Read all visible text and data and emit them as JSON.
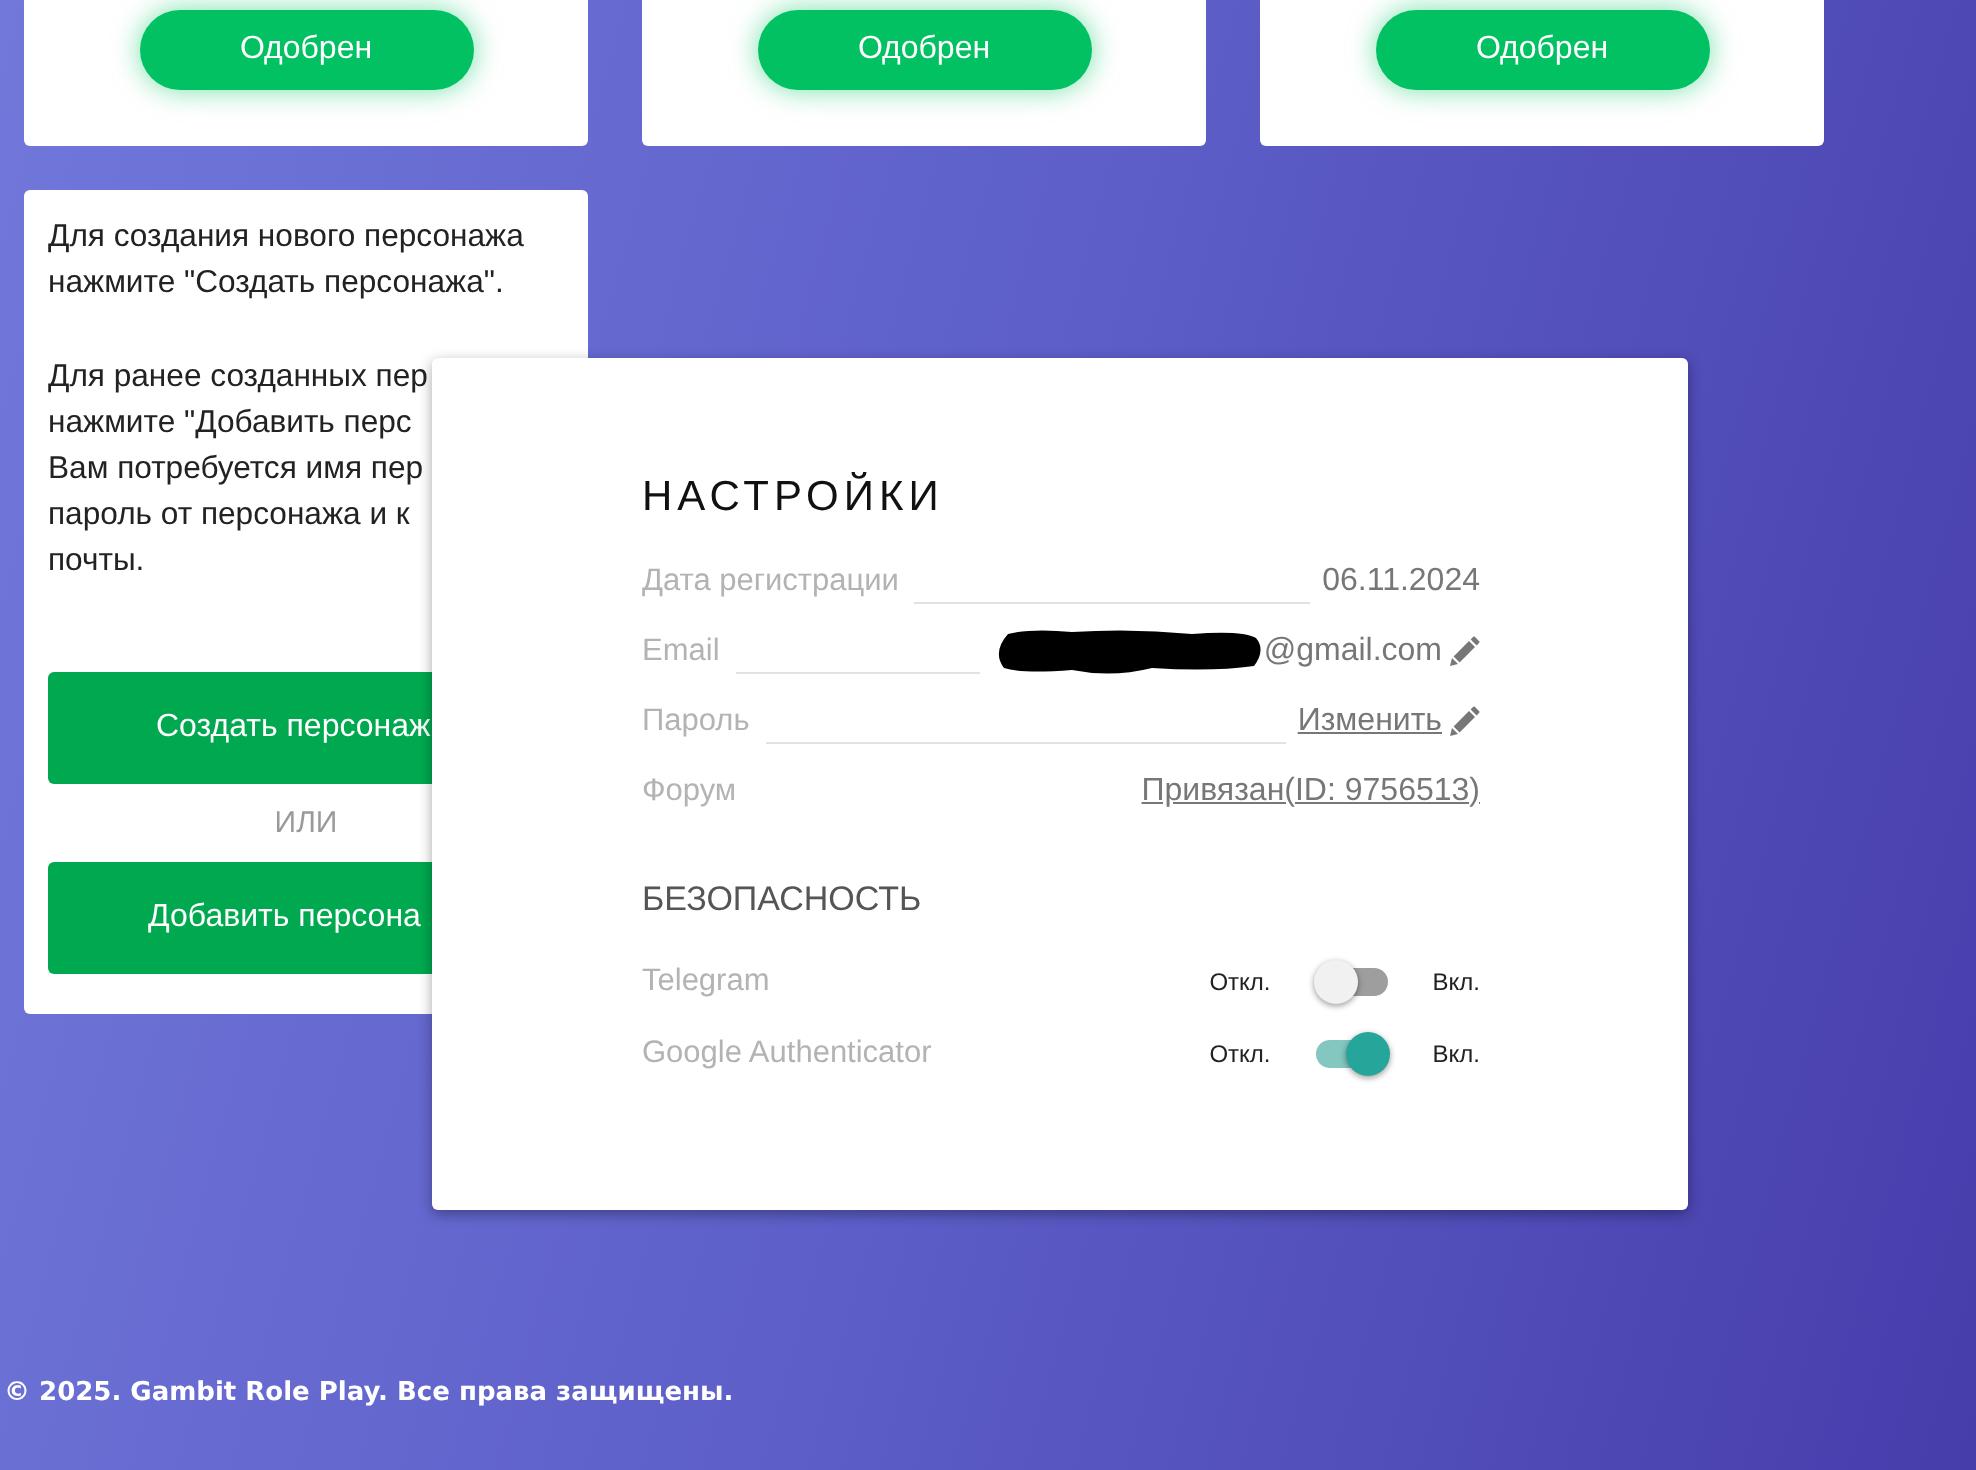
{
  "character_cards": [
    {
      "status": "Одобрен"
    },
    {
      "status": "Одобрен"
    },
    {
      "status": "Одобрен"
    }
  ],
  "info_card": {
    "paragraphs": [
      "Для создания нового персонажа\nнажмите \"Создать персонажа\".",
      "Для ранее созданных пер\nнажмите \"Добавить перс\nВам потребуется имя пер\nпароль от персонажа и к\nпочты."
    ],
    "create_button": "Создать персонаж",
    "separator": "ИЛИ",
    "add_button": "Добавить персона"
  },
  "settings": {
    "title": "НАСТРОЙКИ",
    "rows": [
      {
        "kind": "text",
        "label": "Дата регистрации",
        "value": "06.11.2024",
        "redacted": false
      },
      {
        "kind": "editable",
        "label": "Email",
        "value": "@gmail.com",
        "redacted": true
      },
      {
        "kind": "action",
        "label": "Пароль",
        "value": "Изменить",
        "redacted": false
      },
      {
        "kind": "link",
        "label": "Форум",
        "value": "Привязан(ID: 9756513)",
        "redacted": false
      }
    ],
    "security_title": "БЕЗОПАСНОСТЬ",
    "switches": [
      {
        "label": "Telegram",
        "off_label": "Откл.",
        "on_label": "Вкл.",
        "on": false
      },
      {
        "label": "Google Authenticator",
        "off_label": "Откл.",
        "on_label": "Вкл.",
        "on": true
      }
    ]
  },
  "footer": "© 2025. Gambit Role Play. Все права защищены."
}
